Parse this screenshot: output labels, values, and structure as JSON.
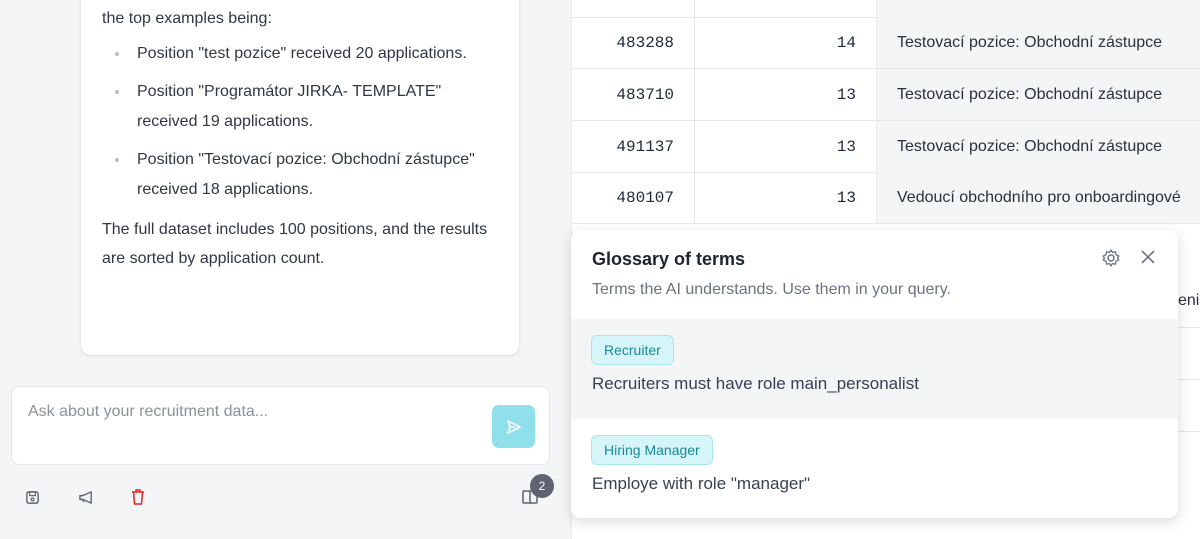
{
  "chat": {
    "intro": "the top examples being:",
    "bullets": [
      "Position \"test pozice\" received 20 applications.",
      "Position \"Programátor JIRKA- TEMPLATE\" received 19 applications.",
      "Position \"Testovací pozice: Obchodní zástupce\" received 18 applications."
    ],
    "summary": "The full dataset includes 100 positions, and the results are sorted by application count.",
    "input_placeholder": "Ask about your recruitment data...",
    "badge_count": "2"
  },
  "table": {
    "rows": [
      {
        "id": "483288",
        "count": "14",
        "position": "Testovací pozice: Obchodní zástupce"
      },
      {
        "id": "483710",
        "count": "13",
        "position": "Testovací pozice: Obchodní zástupce"
      },
      {
        "id": "491137",
        "count": "13",
        "position": "Testovací pozice: Obchodní zástupce"
      },
      {
        "id": "480107",
        "count": "13",
        "position": "Vedoucí obchodního pro onboardingové"
      }
    ],
    "peek_text": "eni"
  },
  "glossary": {
    "title": "Glossary of terms",
    "subtitle": "Terms the AI understands. Use them in your query.",
    "terms": [
      {
        "name": "Recruiter",
        "description": "Recruiters must have role main_personalist"
      },
      {
        "name": "Hiring Manager",
        "description": "Employe with role \"manager\""
      }
    ]
  },
  "colors": {
    "accent": "#8fe0ea",
    "tag_bg": "#d6f5f8",
    "tag_text": "#1a8a99",
    "delete": "#e02424"
  },
  "icons": [
    "save-icon",
    "megaphone-icon",
    "trash-icon",
    "book-icon",
    "send-icon",
    "gear-icon",
    "close-icon"
  ]
}
